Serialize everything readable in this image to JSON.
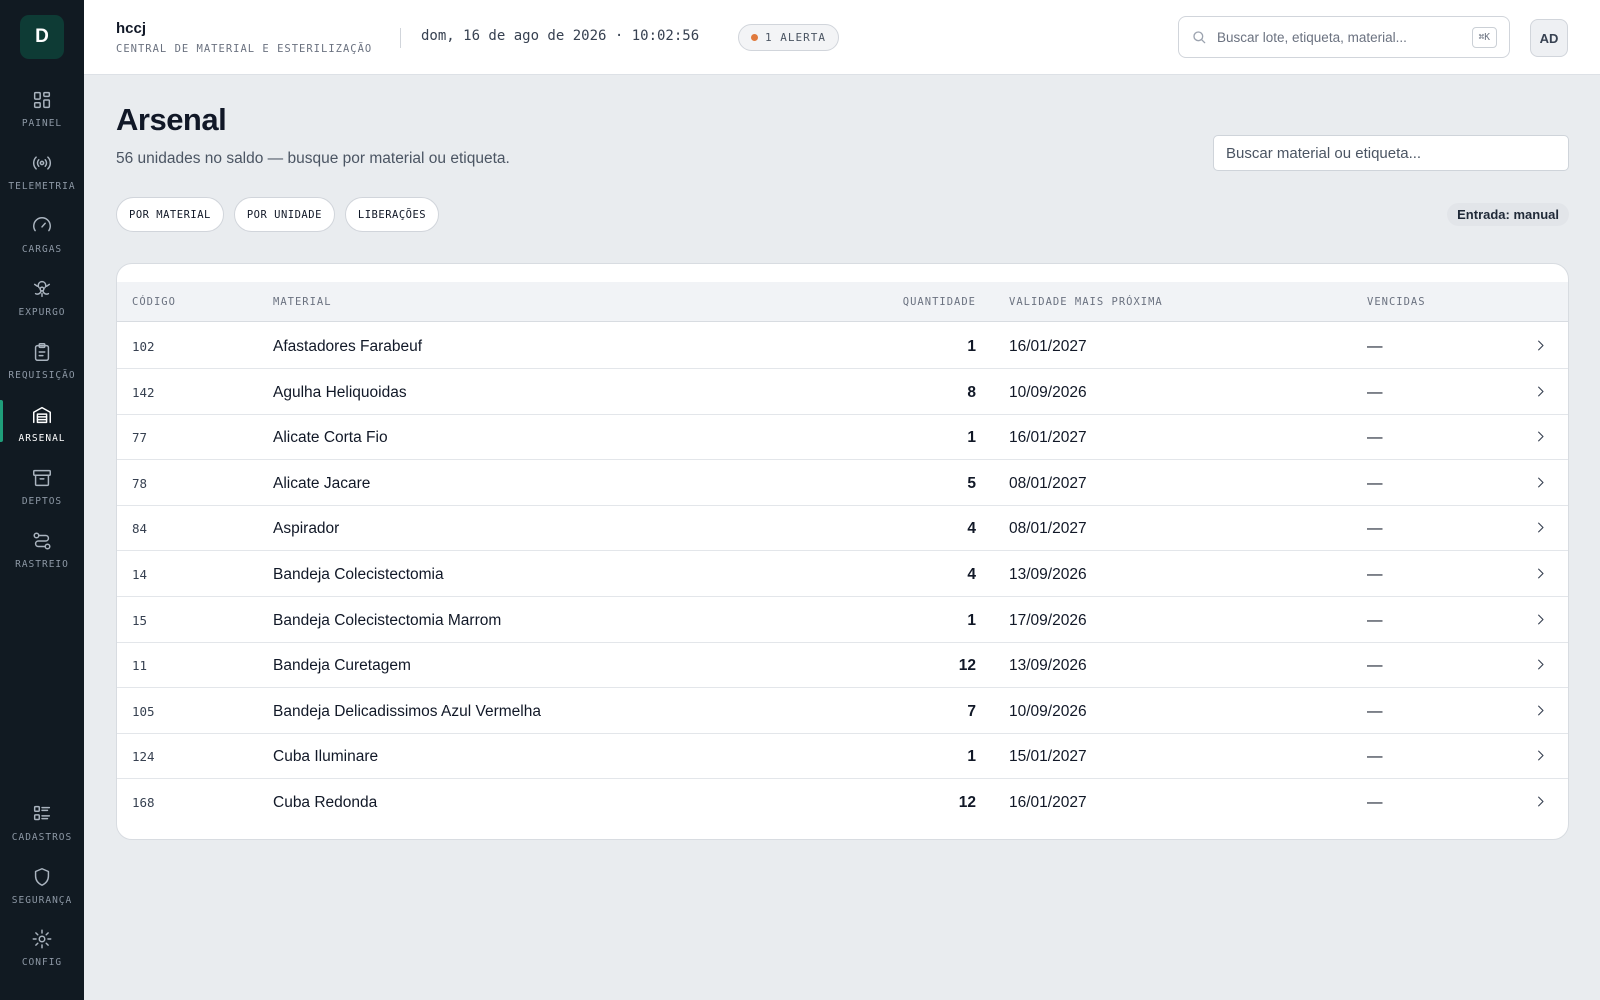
{
  "app": {
    "logo_letter": "D",
    "org_name": "hccj",
    "org_subtitle": "CENTRAL DE MATERIAL E ESTERILIZAÇÃO",
    "datetime": "dom, 16 de ago de 2026 · 10:02:56",
    "alert_label": "1 ALERTA",
    "search_placeholder": "Buscar lote, etiqueta, material...",
    "search_shortcut": "⌘K",
    "avatar_initials": "AD",
    "accent_color": "#1f9e7a",
    "alert_color": "#e07a3d"
  },
  "sidebar": {
    "top_items": [
      {
        "label": "PAINEL",
        "icon": "grid-icon"
      },
      {
        "label": "TELEMETRIA",
        "icon": "broadcast-icon"
      },
      {
        "label": "CARGAS",
        "icon": "gauge-icon"
      },
      {
        "label": "EXPURGO",
        "icon": "biohazard-icon"
      },
      {
        "label": "REQUISIÇÃO",
        "icon": "clipboard-icon"
      },
      {
        "label": "ARSENAL",
        "icon": "warehouse-icon",
        "active": true
      },
      {
        "label": "DEPTOS",
        "icon": "archive-box-icon"
      },
      {
        "label": "RASTREIO",
        "icon": "route-icon"
      }
    ],
    "bottom_items": [
      {
        "label": "CADASTROS",
        "icon": "list-icon"
      },
      {
        "label": "SEGURANÇA",
        "icon": "shield-icon"
      },
      {
        "label": "CONFIG",
        "icon": "gear-icon"
      }
    ]
  },
  "page": {
    "title": "Arsenal",
    "subtitle": "56 unidades no saldo — busque por material ou etiqueta.",
    "search_placeholder": "Buscar material ou etiqueta...",
    "tabs": [
      "POR MATERIAL",
      "POR UNIDADE",
      "LIBERAÇÕES"
    ],
    "entry_mode": "Entrada: manual"
  },
  "table": {
    "columns": [
      "CÓDIGO",
      "MATERIAL",
      "QUANTIDADE",
      "VALIDADE MAIS PRÓXIMA",
      "VENCIDAS"
    ],
    "rows": [
      {
        "code": "102",
        "material": "Afastadores Farabeuf",
        "qty": "1",
        "validity": "16/01/2027",
        "expired": "—"
      },
      {
        "code": "142",
        "material": "Agulha Heliquoidas",
        "qty": "8",
        "validity": "10/09/2026",
        "expired": "—"
      },
      {
        "code": "77",
        "material": "Alicate Corta Fio",
        "qty": "1",
        "validity": "16/01/2027",
        "expired": "—"
      },
      {
        "code": "78",
        "material": "Alicate Jacare",
        "qty": "5",
        "validity": "08/01/2027",
        "expired": "—"
      },
      {
        "code": "84",
        "material": "Aspirador",
        "qty": "4",
        "validity": "08/01/2027",
        "expired": "—"
      },
      {
        "code": "14",
        "material": "Bandeja Colecistectomia",
        "qty": "4",
        "validity": "13/09/2026",
        "expired": "—"
      },
      {
        "code": "15",
        "material": "Bandeja Colecistectomia Marrom",
        "qty": "1",
        "validity": "17/09/2026",
        "expired": "—"
      },
      {
        "code": "11",
        "material": "Bandeja Curetagem",
        "qty": "12",
        "validity": "13/09/2026",
        "expired": "—"
      },
      {
        "code": "105",
        "material": "Bandeja Delicadissimos Azul Vermelha",
        "qty": "7",
        "validity": "10/09/2026",
        "expired": "—"
      },
      {
        "code": "124",
        "material": "Cuba Iluminare",
        "qty": "1",
        "validity": "15/01/2027",
        "expired": "—"
      },
      {
        "code": "168",
        "material": "Cuba Redonda",
        "qty": "12",
        "validity": "16/01/2027",
        "expired": "—"
      }
    ]
  }
}
